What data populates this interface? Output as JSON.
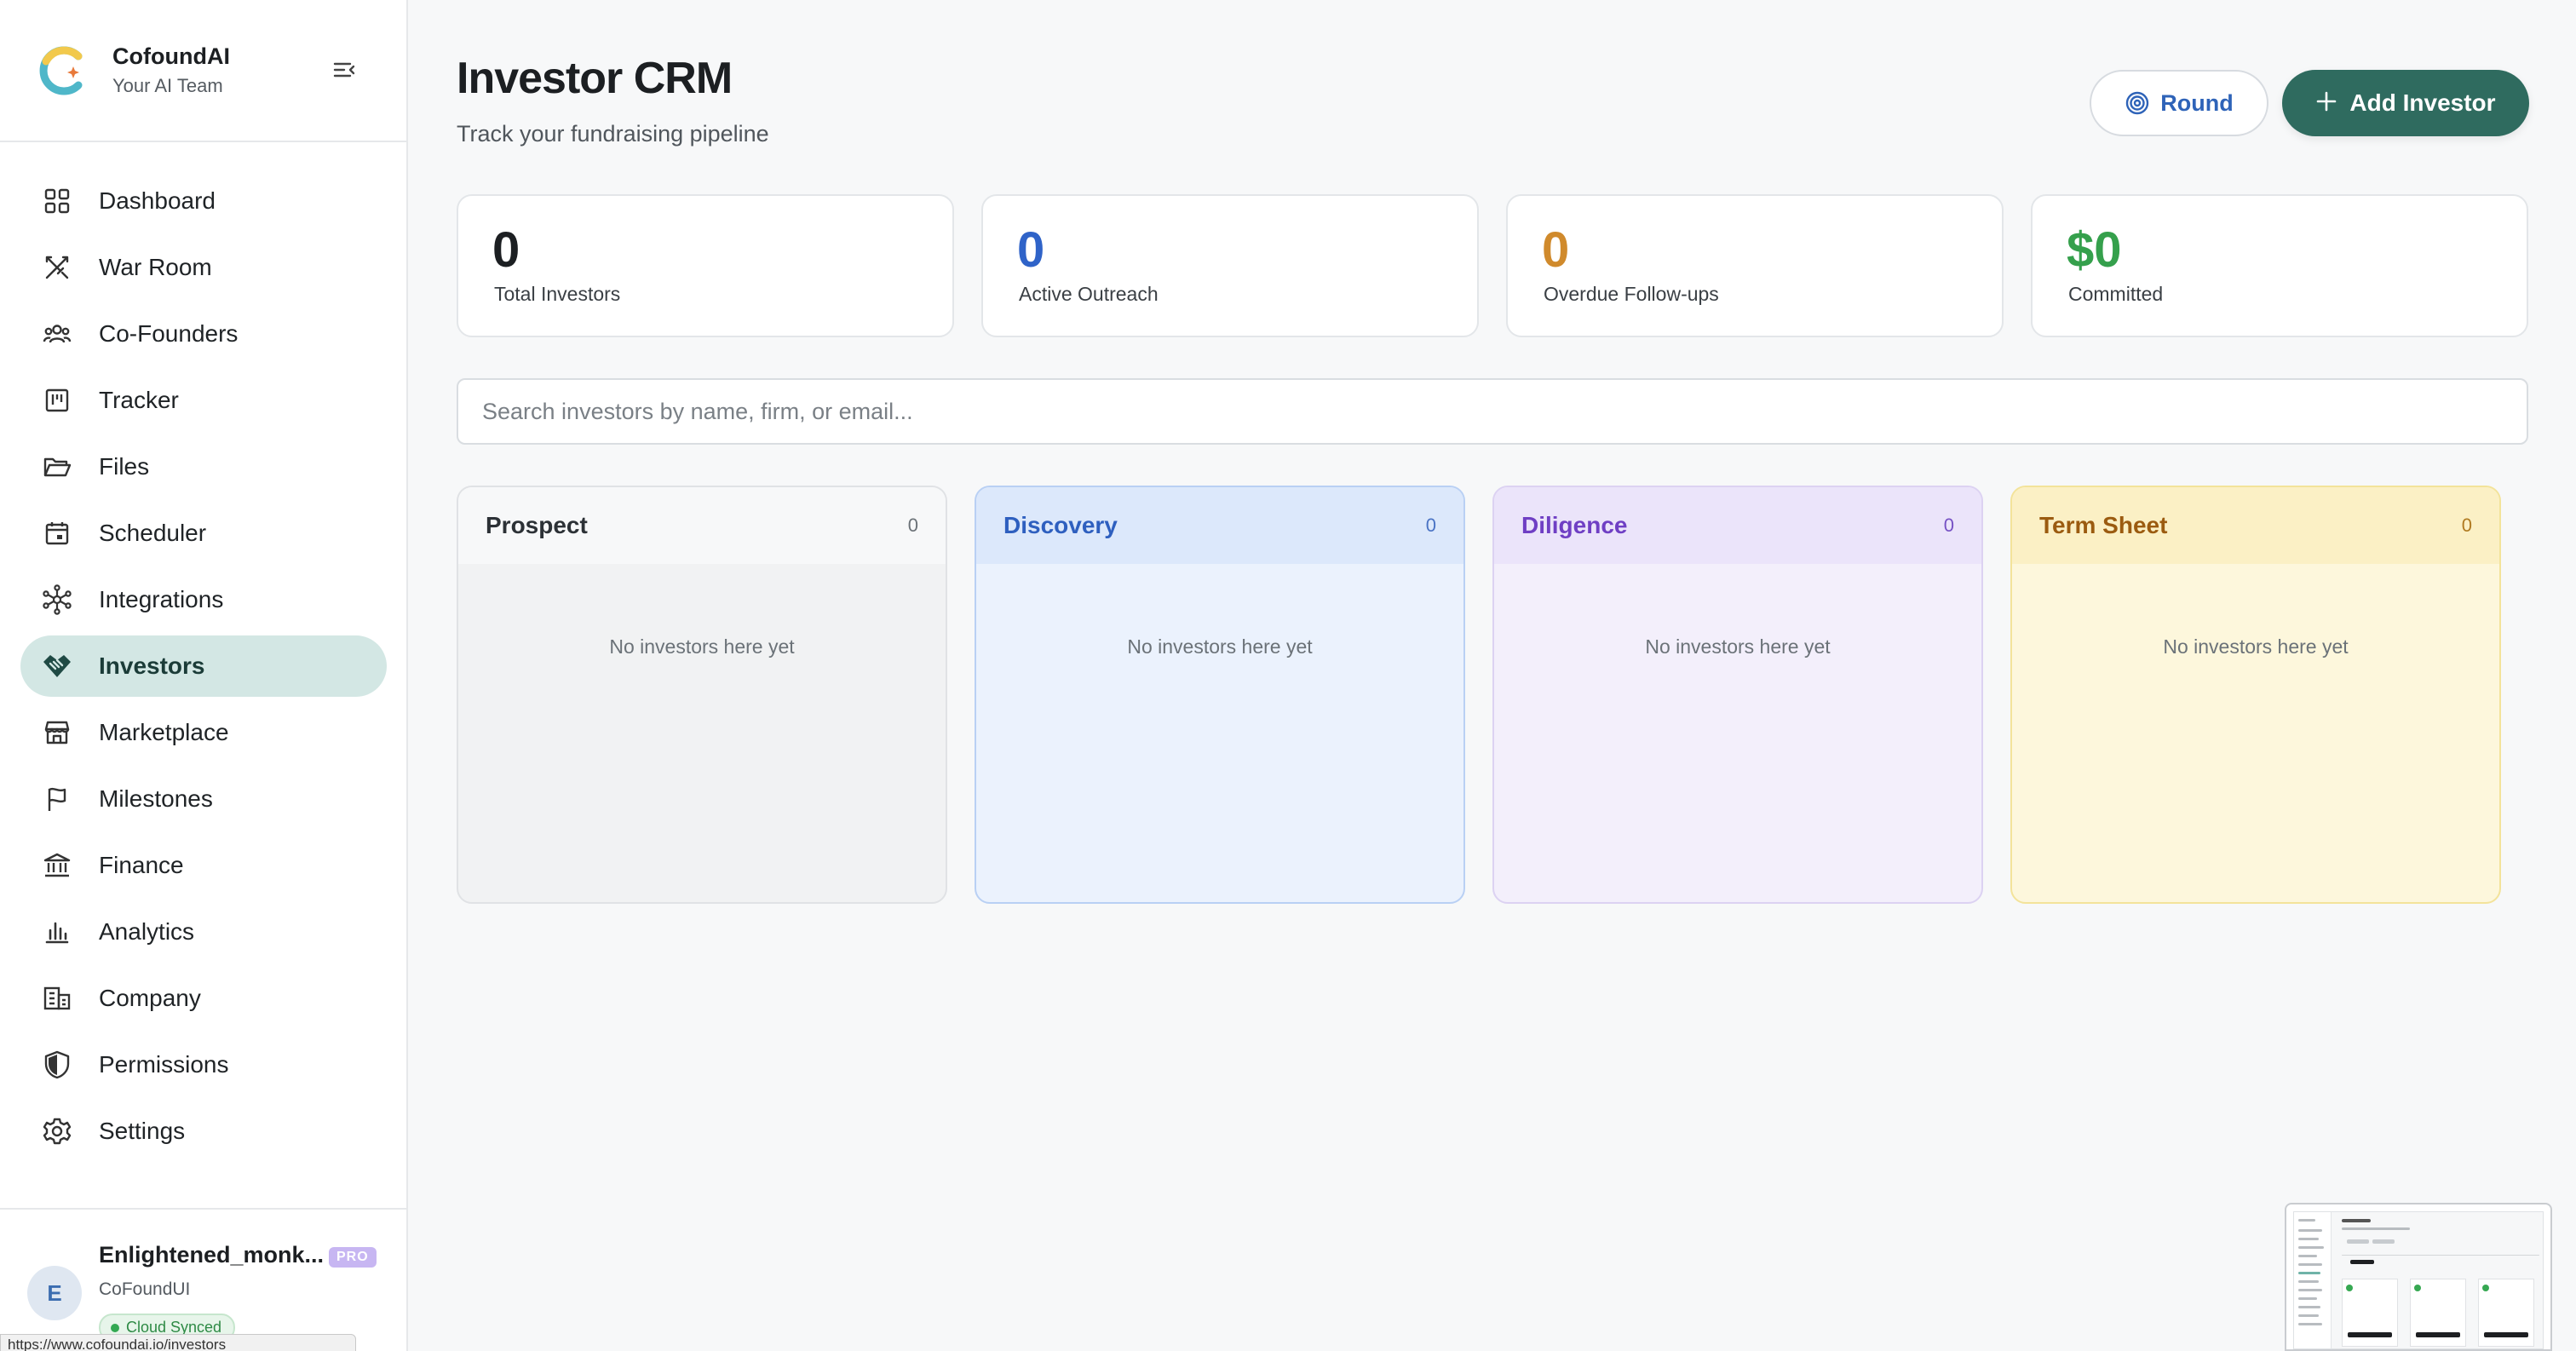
{
  "brand": {
    "name": "CofoundAI",
    "tagline": "Your AI Team"
  },
  "nav": {
    "items": [
      {
        "label": "Dashboard",
        "icon": "grid-icon"
      },
      {
        "label": "War Room",
        "icon": "swords-icon"
      },
      {
        "label": "Co-Founders",
        "icon": "users-icon"
      },
      {
        "label": "Tracker",
        "icon": "kanban-icon"
      },
      {
        "label": "Files",
        "icon": "folder-icon"
      },
      {
        "label": "Scheduler",
        "icon": "calendar-icon"
      },
      {
        "label": "Integrations",
        "icon": "network-icon"
      },
      {
        "label": "Investors",
        "icon": "handshake-icon",
        "active": true
      },
      {
        "label": "Marketplace",
        "icon": "store-icon"
      },
      {
        "label": "Milestones",
        "icon": "flag-icon"
      },
      {
        "label": "Finance",
        "icon": "bank-icon"
      },
      {
        "label": "Analytics",
        "icon": "bar-chart-icon"
      },
      {
        "label": "Company",
        "icon": "building-icon"
      },
      {
        "label": "Permissions",
        "icon": "shield-icon"
      },
      {
        "label": "Settings",
        "icon": "gear-icon"
      }
    ]
  },
  "user": {
    "initial": "E",
    "name": "Enlightened_monk...",
    "badge": "PRO",
    "org": "CoFoundUI",
    "sync_status": "Cloud Synced"
  },
  "status_bar": {
    "url": "https://www.cofoundai.io/investors"
  },
  "header": {
    "title": "Investor CRM",
    "subtitle": "Track your fundraising pipeline",
    "round_label": "Round",
    "add_label": "Add Investor"
  },
  "stats": [
    {
      "value": "0",
      "label": "Total Investors",
      "color": "#1c1f22"
    },
    {
      "value": "0",
      "label": "Active Outreach",
      "color": "#2f63c8"
    },
    {
      "value": "0",
      "label": "Overdue Follow-ups",
      "color": "#d08a2c"
    },
    {
      "value": "$0",
      "label": "Committed",
      "color": "#35a04c"
    }
  ],
  "search": {
    "placeholder": "Search investors by name, firm, or email...",
    "value": ""
  },
  "pipeline": {
    "columns": [
      {
        "title": "Prospect",
        "count": "0",
        "empty_text": "No investors here yet"
      },
      {
        "title": "Discovery",
        "count": "0",
        "empty_text": "No investors here yet"
      },
      {
        "title": "Diligence",
        "count": "0",
        "empty_text": "No investors here yet"
      },
      {
        "title": "Term Sheet",
        "count": "0",
        "empty_text": "No investors here yet"
      }
    ]
  },
  "colors": {
    "accent": "#2f6b5f",
    "active_nav_bg": "#d3e7e4"
  }
}
